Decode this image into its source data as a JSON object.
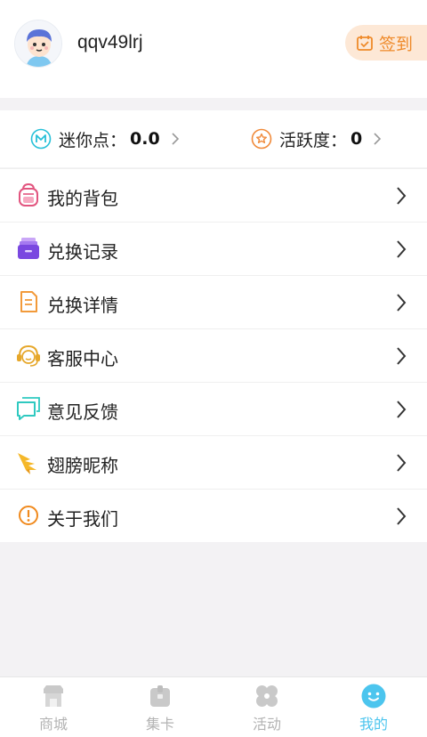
{
  "profile": {
    "username": "qqv49lrj",
    "checkin_label": "签到"
  },
  "stats": {
    "mini_label": "迷你点：",
    "mini_value": "0.0",
    "activity_label": "活跃度：",
    "activity_value": "0"
  },
  "menu": {
    "items": [
      {
        "label": "我的背包",
        "icon": "backpack-icon"
      },
      {
        "label": "兑换记录",
        "icon": "drawer-icon"
      },
      {
        "label": "兑换详情",
        "icon": "document-icon"
      },
      {
        "label": "客服中心",
        "icon": "headset-icon"
      },
      {
        "label": "意见反馈",
        "icon": "chat-bubble-icon"
      },
      {
        "label": "翅膀昵称",
        "icon": "wing-icon"
      },
      {
        "label": "关于我们",
        "icon": "info-icon"
      }
    ]
  },
  "tabbar": {
    "items": [
      {
        "label": "商城",
        "icon": "shop-icon"
      },
      {
        "label": "集卡",
        "icon": "card-box-icon"
      },
      {
        "label": "活动",
        "icon": "clover-icon"
      },
      {
        "label": "我的",
        "icon": "smile-icon"
      }
    ],
    "active_index": 3
  },
  "colors": {
    "accent": "#4cc5ee",
    "checkin": "#ef8a2a",
    "checkin_bg": "#fde8d6",
    "mini_icon": "#27c0d8",
    "activity_icon": "#f08a3a"
  }
}
